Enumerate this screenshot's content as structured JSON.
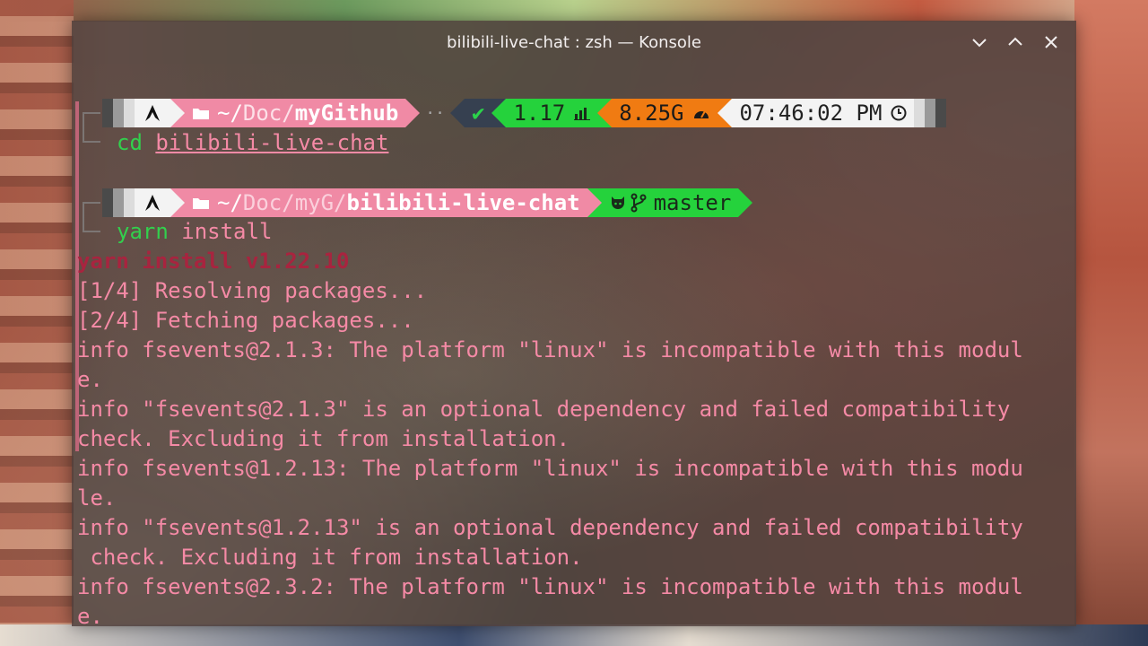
{
  "window": {
    "title": "bilibili-live-chat : zsh — Konsole"
  },
  "prompt1": {
    "path_prefix": "~/",
    "path_mid": "Doc/",
    "path_last": "myGithub",
    "dots": "··",
    "status": "✔",
    "load": "1.17",
    "mem": "8.25G",
    "time": "07:46:02 PM"
  },
  "cmd1": {
    "keyword": "cd",
    "arg": "bilibili-live-chat"
  },
  "prompt2": {
    "path_prefix": "~/",
    "path_mid1": "Doc/",
    "path_mid2": "myG/",
    "path_last": "bilibili-live-chat",
    "branch": "master"
  },
  "cmd2": {
    "keyword": "yarn",
    "arg": "install"
  },
  "output": [
    "yarn install v1.22.10",
    "[1/4] Resolving packages...",
    "[2/4] Fetching packages...",
    "info fsevents@2.1.3: The platform \"linux\" is incompatible with this modul",
    "e.",
    "info \"fsevents@2.1.3\" is an optional dependency and failed compatibility",
    "check. Excluding it from installation.",
    "info fsevents@1.2.13: The platform \"linux\" is incompatible with this modu",
    "le.",
    "info \"fsevents@1.2.13\" is an optional dependency and failed compatibility",
    " check. Excluding it from installation.",
    "info fsevents@2.3.2: The platform \"linux\" is incompatible with this modul",
    "e."
  ],
  "icons": [
    "arch-logo-icon",
    "folder-icon",
    "bar-chart-icon",
    "gauge-icon",
    "clock-icon",
    "github-icon",
    "git-branch-icon",
    "minimize-icon",
    "maximize-icon",
    "close-icon"
  ],
  "colors": {
    "pink": "#f08aa5",
    "green": "#25d23c",
    "orange": "#f07b12",
    "dark": "#364050",
    "text_output": "#f58aa6",
    "command_green": "#32d04d"
  }
}
